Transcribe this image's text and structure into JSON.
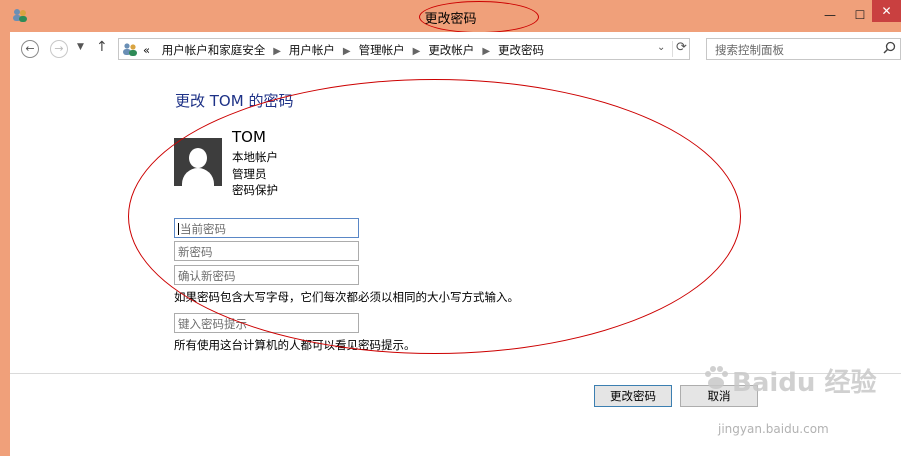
{
  "window": {
    "title": "更改密码",
    "min_glyph": "—",
    "max_glyph": "☐",
    "close_glyph": "✕"
  },
  "nav": {
    "back_glyph": "←",
    "forward_glyph": "→",
    "up_glyph": "↑",
    "breadcrumb_lead": "«",
    "breadcrumbs": [
      "用户帐户和家庭安全",
      "用户帐户",
      "管理帐户",
      "更改帐户",
      "更改密码"
    ],
    "search_placeholder": "搜索控制面板"
  },
  "main": {
    "title": "更改 TOM 的密码",
    "user": {
      "name": "TOM",
      "type": "本地帐户",
      "role": "管理员",
      "protection": "密码保护"
    },
    "fields": {
      "current_password_placeholder": "当前密码",
      "new_password_placeholder": "新密码",
      "confirm_password_placeholder": "确认新密码",
      "hint_placeholder": "键入密码提示"
    },
    "case_note": "如果密码包含大写字母，它们每次都必须以相同的大小写方式输入。",
    "hint_note": "所有使用这台计算机的人都可以看见密码提示。"
  },
  "footer": {
    "change_label": "更改密码",
    "cancel_label": "取消"
  },
  "watermark": {
    "brand": "Baidu 经验",
    "url": "jingyan.baidu.com"
  },
  "colors": {
    "frame": "#f0a07a",
    "title_blue": "#1e3287",
    "annotation_red": "#cc0000"
  }
}
